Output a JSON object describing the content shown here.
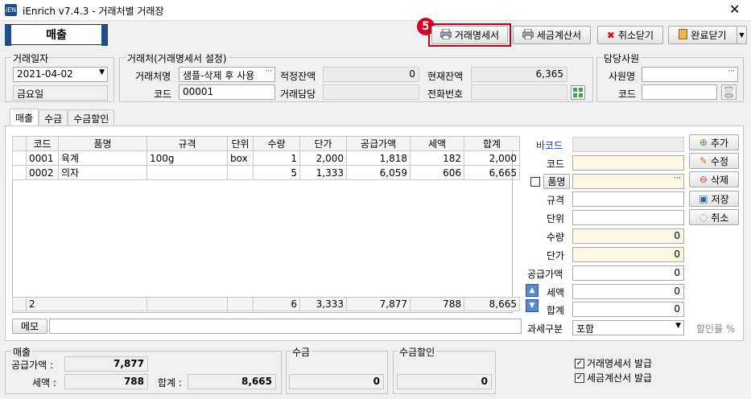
{
  "window": {
    "logo": "iEN",
    "title": "iEnrich v7.4.3 - 거래처별 거래장",
    "close": "✕"
  },
  "mode": {
    "label": "매출"
  },
  "badge": "5",
  "toolbar": {
    "invoice": "거래명세서",
    "tax": "세금계산서",
    "cancel": "취소닫기",
    "done": "완료닫기",
    "more": "▼"
  },
  "date_group": {
    "title": "거래일자",
    "date": "2021-04-02",
    "weekday": "금요일"
  },
  "client_group": {
    "title": "거래처(거래명세서 설정)",
    "name_label": "거래처명",
    "name_value": "샘플-삭제 후 사용",
    "code_label": "코드",
    "code_value": "00001",
    "proper_label": "적정잔액",
    "proper_value": "0",
    "current_label": "현재잔액",
    "current_value": "6,365",
    "manager_label": "거래담당",
    "phone_label": "전화번호"
  },
  "staff_group": {
    "title": "담당사원",
    "name_label": "사원명",
    "code_label": "코드"
  },
  "tabs": [
    {
      "label": "매출"
    },
    {
      "label": "수금"
    },
    {
      "label": "수금할인"
    }
  ],
  "table": {
    "headers": [
      "코드",
      "품명",
      "규격",
      "단위",
      "수량",
      "단가",
      "공급가액",
      "세액",
      "합계"
    ],
    "rows": [
      [
        "0001",
        "육계",
        "100g",
        "box",
        "1",
        "2,000",
        "1,818",
        "182",
        "2,000"
      ],
      [
        "0002",
        "의자",
        "",
        "",
        "5",
        "1,333",
        "6,059",
        "606",
        "6,665"
      ]
    ],
    "footer": [
      "",
      "2",
      "",
      "",
      "6",
      "3,333",
      "7,877",
      "788",
      "8,665"
    ]
  },
  "memo_label": "메모",
  "form": {
    "barcode": "바코드",
    "code": "코드",
    "name": "품명",
    "spec": "규격",
    "unit": "단위",
    "qty": "수량",
    "qty_value": "0",
    "price": "단가",
    "price_value": "0",
    "supply": "공급가액",
    "supply_value": "0",
    "tax": "세액",
    "tax_value": "0",
    "total": "합계",
    "total_value": "0",
    "taxtype": "과세구분",
    "taxtype_value": "포함",
    "discount": "할인률 %"
  },
  "side": {
    "add": "추가",
    "edit": "수정",
    "delete": "삭제",
    "save": "저장",
    "cancel": "취소"
  },
  "summary": {
    "sales_title": "매출",
    "supply_label": "공급가액 :",
    "supply_value": "7,877",
    "tax_label": "세액 :",
    "tax_value": "788",
    "total_label": "합계 :",
    "total_value": "8,665",
    "collect_title": "수금",
    "collect_value": "0",
    "disc_title": "수금할인",
    "disc_value": "0"
  },
  "checks": {
    "invoice": "거래명세서 발급",
    "tax": "세금계산서 발급"
  }
}
